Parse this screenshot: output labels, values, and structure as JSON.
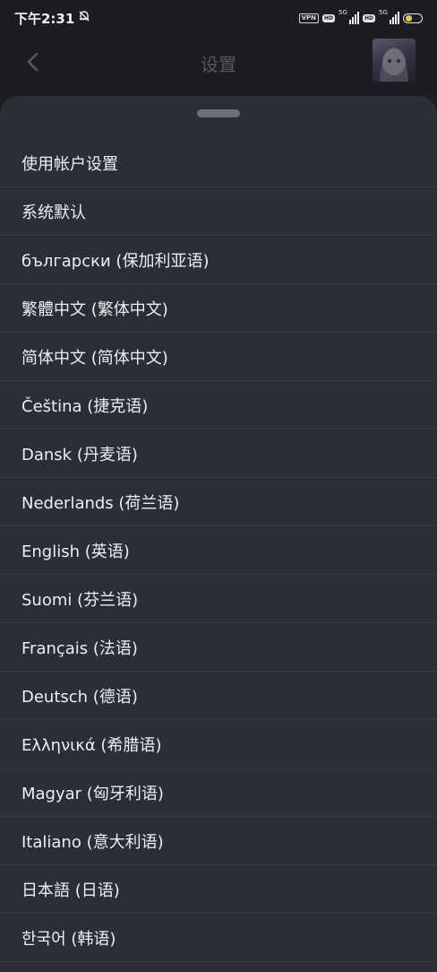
{
  "status_bar": {
    "time": "下午2:31",
    "vpn_label": "VPN",
    "hd_label": "HD",
    "network_label": "5G",
    "battery_level_percent": 45
  },
  "header": {
    "title": "设置"
  },
  "language_options": [
    {
      "label": "使用帐户设置"
    },
    {
      "label": "系统默认"
    },
    {
      "label": "български (保加利亚语)"
    },
    {
      "label": "繁體中文 (繁体中文)"
    },
    {
      "label": "简体中文 (简体中文)"
    },
    {
      "label": "Čeština (捷克语)"
    },
    {
      "label": "Dansk (丹麦语)"
    },
    {
      "label": "Nederlands (荷兰语)"
    },
    {
      "label": "English (英语)"
    },
    {
      "label": "Suomi (芬兰语)"
    },
    {
      "label": "Français (法语)"
    },
    {
      "label": "Deutsch (德语)"
    },
    {
      "label": "Ελληνικά (希腊语)"
    },
    {
      "label": "Magyar (匈牙利语)"
    },
    {
      "label": "Italiano (意大利语)"
    },
    {
      "label": "日本語 (日语)"
    },
    {
      "label": "한국어 (韩语)"
    }
  ],
  "colors": {
    "background": "#1b1d22",
    "sheet": "#2b2e34",
    "text": "#eceef2",
    "divider": "#363940"
  }
}
